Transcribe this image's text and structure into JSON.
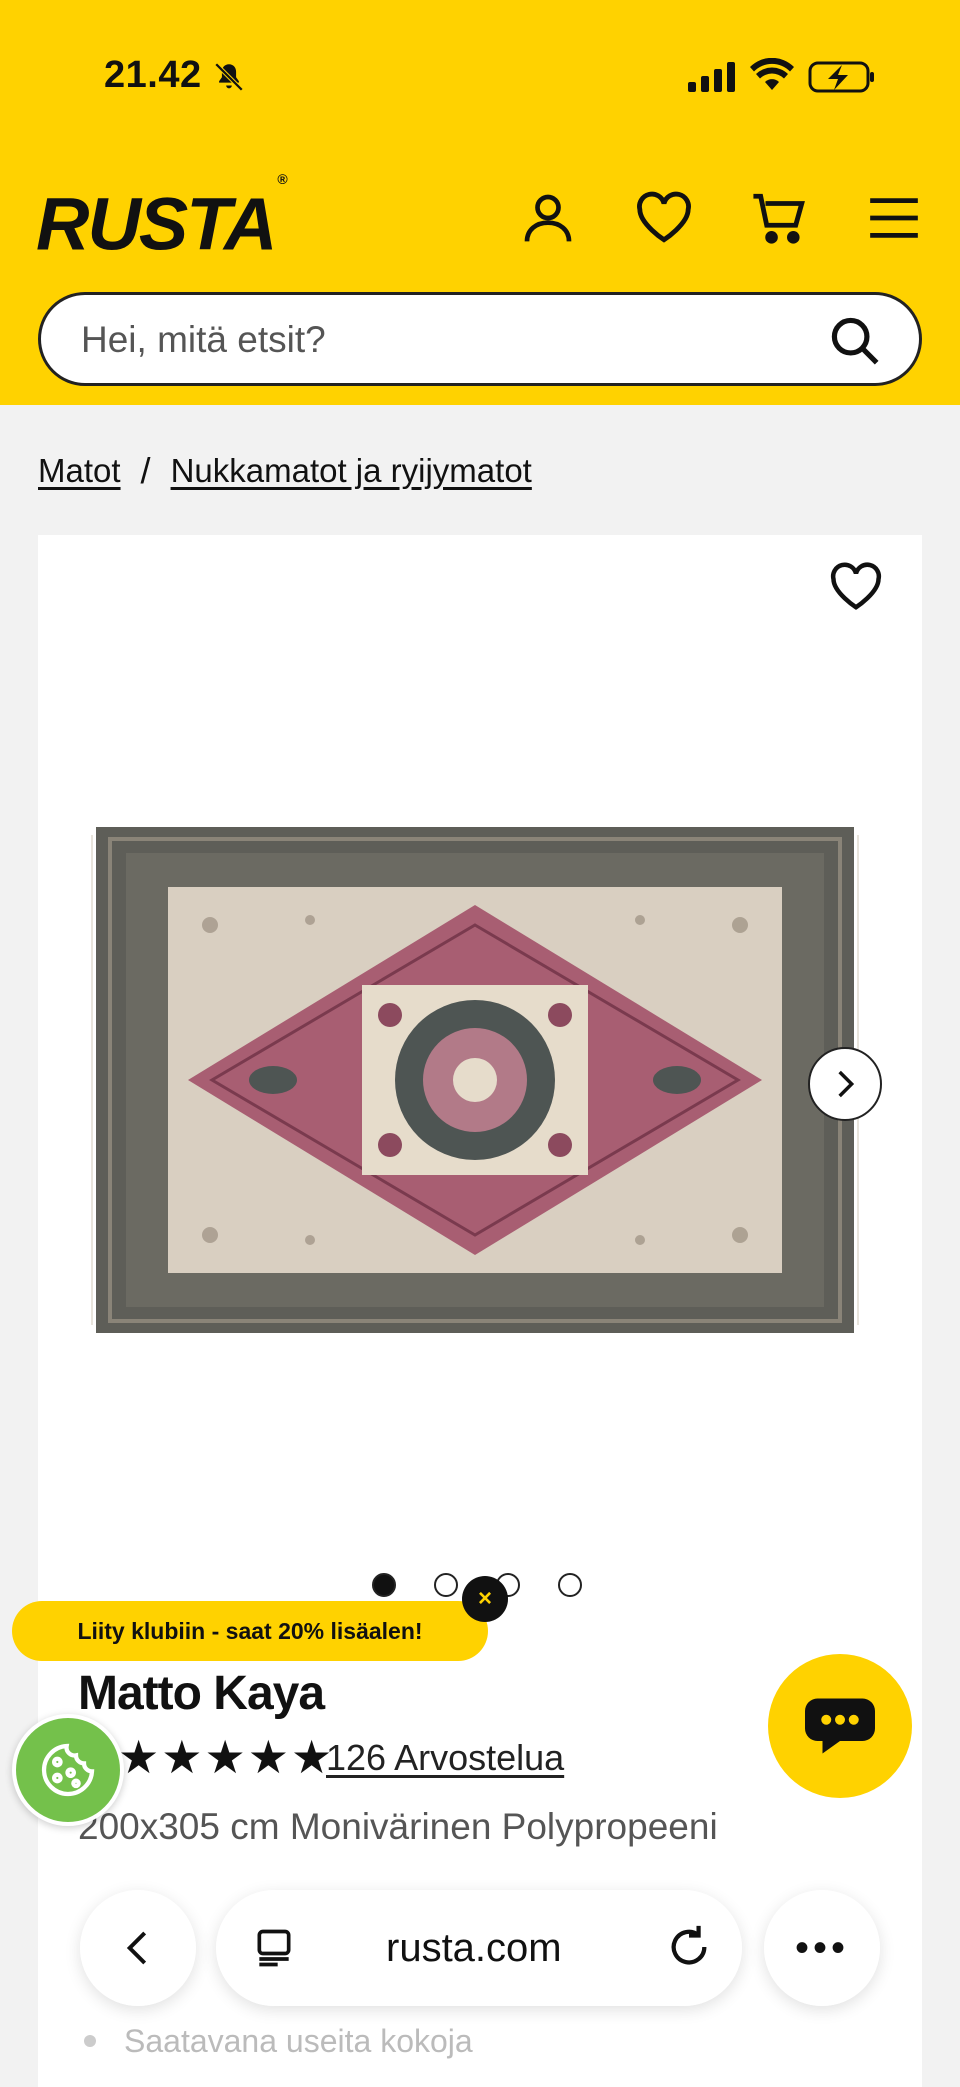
{
  "status_bar": {
    "time": "21.42"
  },
  "header": {
    "logo": "RUSTA",
    "logo_mark": "®",
    "search_placeholder": "Hei, mitä etsit?"
  },
  "breadcrumb": {
    "items": [
      "Matot",
      "Nukkamatot ja ryijymatot"
    ],
    "separator": "/"
  },
  "gallery": {
    "image_count": 4,
    "active_index": 0
  },
  "promo": {
    "text": "Liity klubiin - saat 20% lisäalen!",
    "close": "×"
  },
  "product": {
    "title": "Matto Kaya",
    "rating_stars": "★★★★★",
    "reviews": "126 Arvostelua",
    "subtitle": "200x305 cm Monivärinen Polypropeeni",
    "bullets": [
      "Saatavana useita kokoja"
    ]
  },
  "browser_bar": {
    "url": "rusta.com",
    "more": "•••"
  },
  "colors": {
    "brand_yellow": "#ffd200",
    "cookie_green": "#74c14b"
  }
}
